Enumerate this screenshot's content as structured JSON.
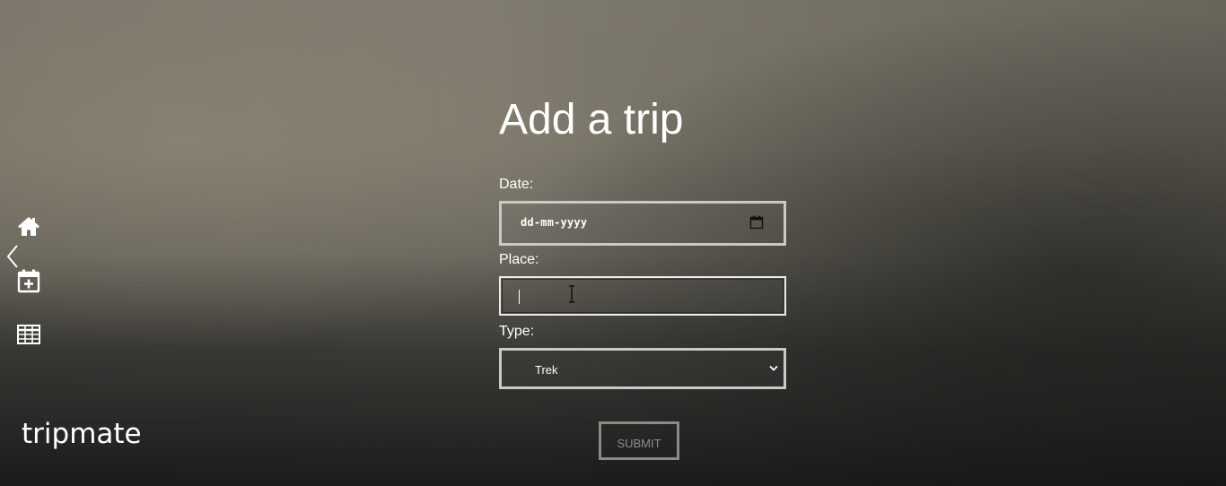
{
  "brand": {
    "name": "tripmate"
  },
  "sidebar": {
    "items": [
      {
        "name": "home",
        "icon": "home-icon"
      },
      {
        "name": "add-trip",
        "icon": "calendar-plus-icon"
      },
      {
        "name": "trips-table",
        "icon": "table-icon"
      }
    ],
    "collapse_icon": "chevron-left-icon"
  },
  "form": {
    "title": "Add a trip",
    "date_label": "Date:",
    "date_placeholder": "dd-mm-yyyy",
    "place_label": "Place:",
    "place_value": "",
    "type_label": "Type:",
    "type_selected": "Trek",
    "submit_label": "SUBMIT"
  },
  "colors": {
    "text": "#ffffff",
    "field_border": "#c9c9c9",
    "submit_border": "#8a8a8a",
    "submit_text": "#8e8e8e"
  }
}
